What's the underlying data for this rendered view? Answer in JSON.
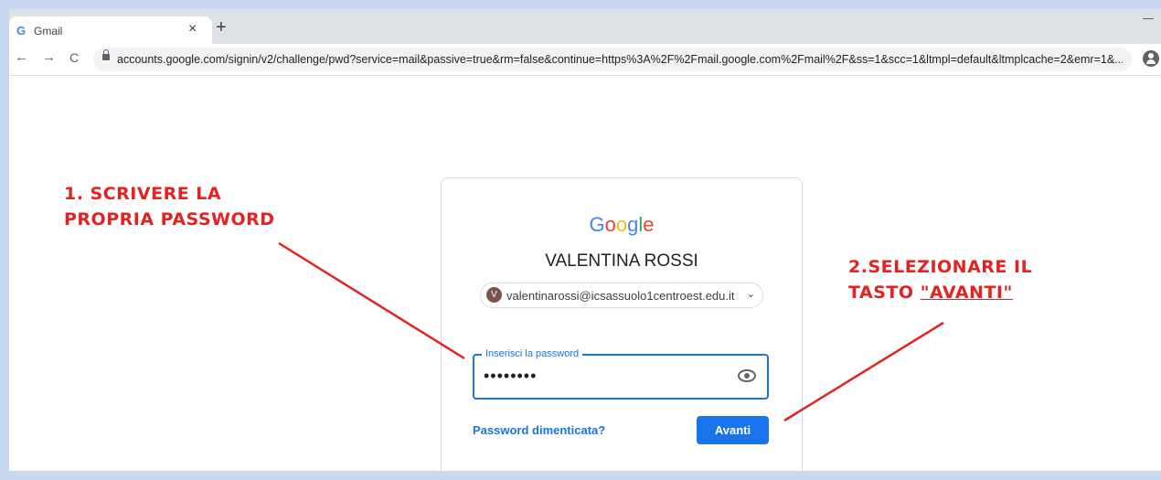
{
  "browser": {
    "tab_favicon": "G",
    "tab_title": "Gmail",
    "tab_close": "×",
    "new_tab": "+",
    "back_icon": "←",
    "forward_icon": "→",
    "reload_icon": "C",
    "url": "accounts.google.com/signin/v2/challenge/pwd?service=mail&passive=true&rm=false&continue=https%3A%2F%2Fmail.google.com%2Fmail%2F&ss=1&scc=1&ltmpl=default&ltmplcache=2&emr=1&..."
  },
  "signin": {
    "logo": [
      "G",
      "o",
      "o",
      "g",
      "l",
      "e"
    ],
    "user_name": "VALENTINA ROSSI",
    "avatar_letter": "V",
    "email": "valentinarossi@icsassuolo1centroest.edu.it",
    "chevron": "⌄",
    "password_label": "Inserisci la password",
    "password_value": "••••••••",
    "forgot_link": "Password dimenticata?",
    "next_button": "Avanti"
  },
  "annotations": {
    "step1_line1": "1. SCRIVERE LA",
    "step1_line2": "PROPRIA PASSWORD",
    "step2_line1": "2.SELEZIONARE IL",
    "step2_prefix": "TASTO ",
    "step2_highlight": "\"AVANTI\"",
    "color": "#e32222"
  },
  "colors": {
    "accent": "#1a73e8",
    "background_frame": "#c9d7f0"
  }
}
